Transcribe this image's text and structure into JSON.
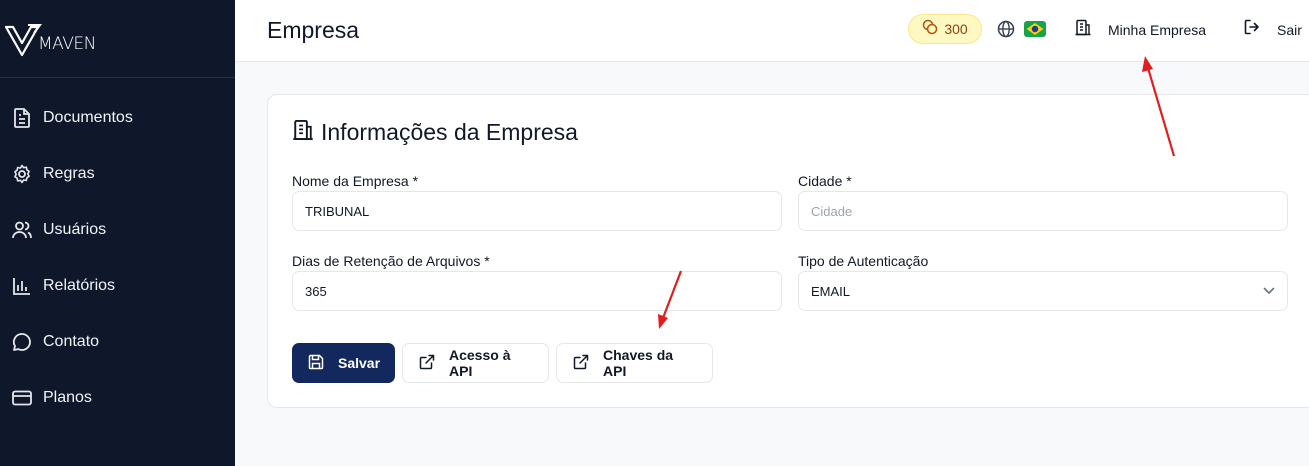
{
  "sidebar": {
    "logo_text": "MAVEN",
    "items": [
      {
        "label": "Documentos",
        "icon": "document-icon"
      },
      {
        "label": "Regras",
        "icon": "gear-icon"
      },
      {
        "label": "Usuários",
        "icon": "users-icon"
      },
      {
        "label": "Relatórios",
        "icon": "bar-chart-icon"
      },
      {
        "label": "Contato",
        "icon": "chat-bubble-icon"
      },
      {
        "label": "Planos",
        "icon": "credit-card-icon"
      }
    ]
  },
  "header": {
    "title": "Empresa",
    "credits": "300",
    "company_label": "Minha Empresa",
    "logout_label": "Sair"
  },
  "card": {
    "title": "Informações da Empresa",
    "fields": {
      "company_name": {
        "label": "Nome da Empresa *",
        "value": "TRIBUNAL"
      },
      "city": {
        "label": "Cidade *",
        "value": "",
        "placeholder": "Cidade"
      },
      "retention": {
        "label": "Dias de Retenção de Arquivos *",
        "value": "365"
      },
      "auth_type": {
        "label": "Tipo de Autenticação",
        "value": "EMAIL"
      }
    },
    "buttons": {
      "save": "Salvar",
      "api_access": "Acesso à API",
      "api_keys": "Chaves da API"
    }
  },
  "colors": {
    "sidebar_bg": "#0f172a",
    "primary": "#13295e",
    "annotation_arrow": "#e11d1d",
    "credits_bg": "#fef9c3"
  }
}
